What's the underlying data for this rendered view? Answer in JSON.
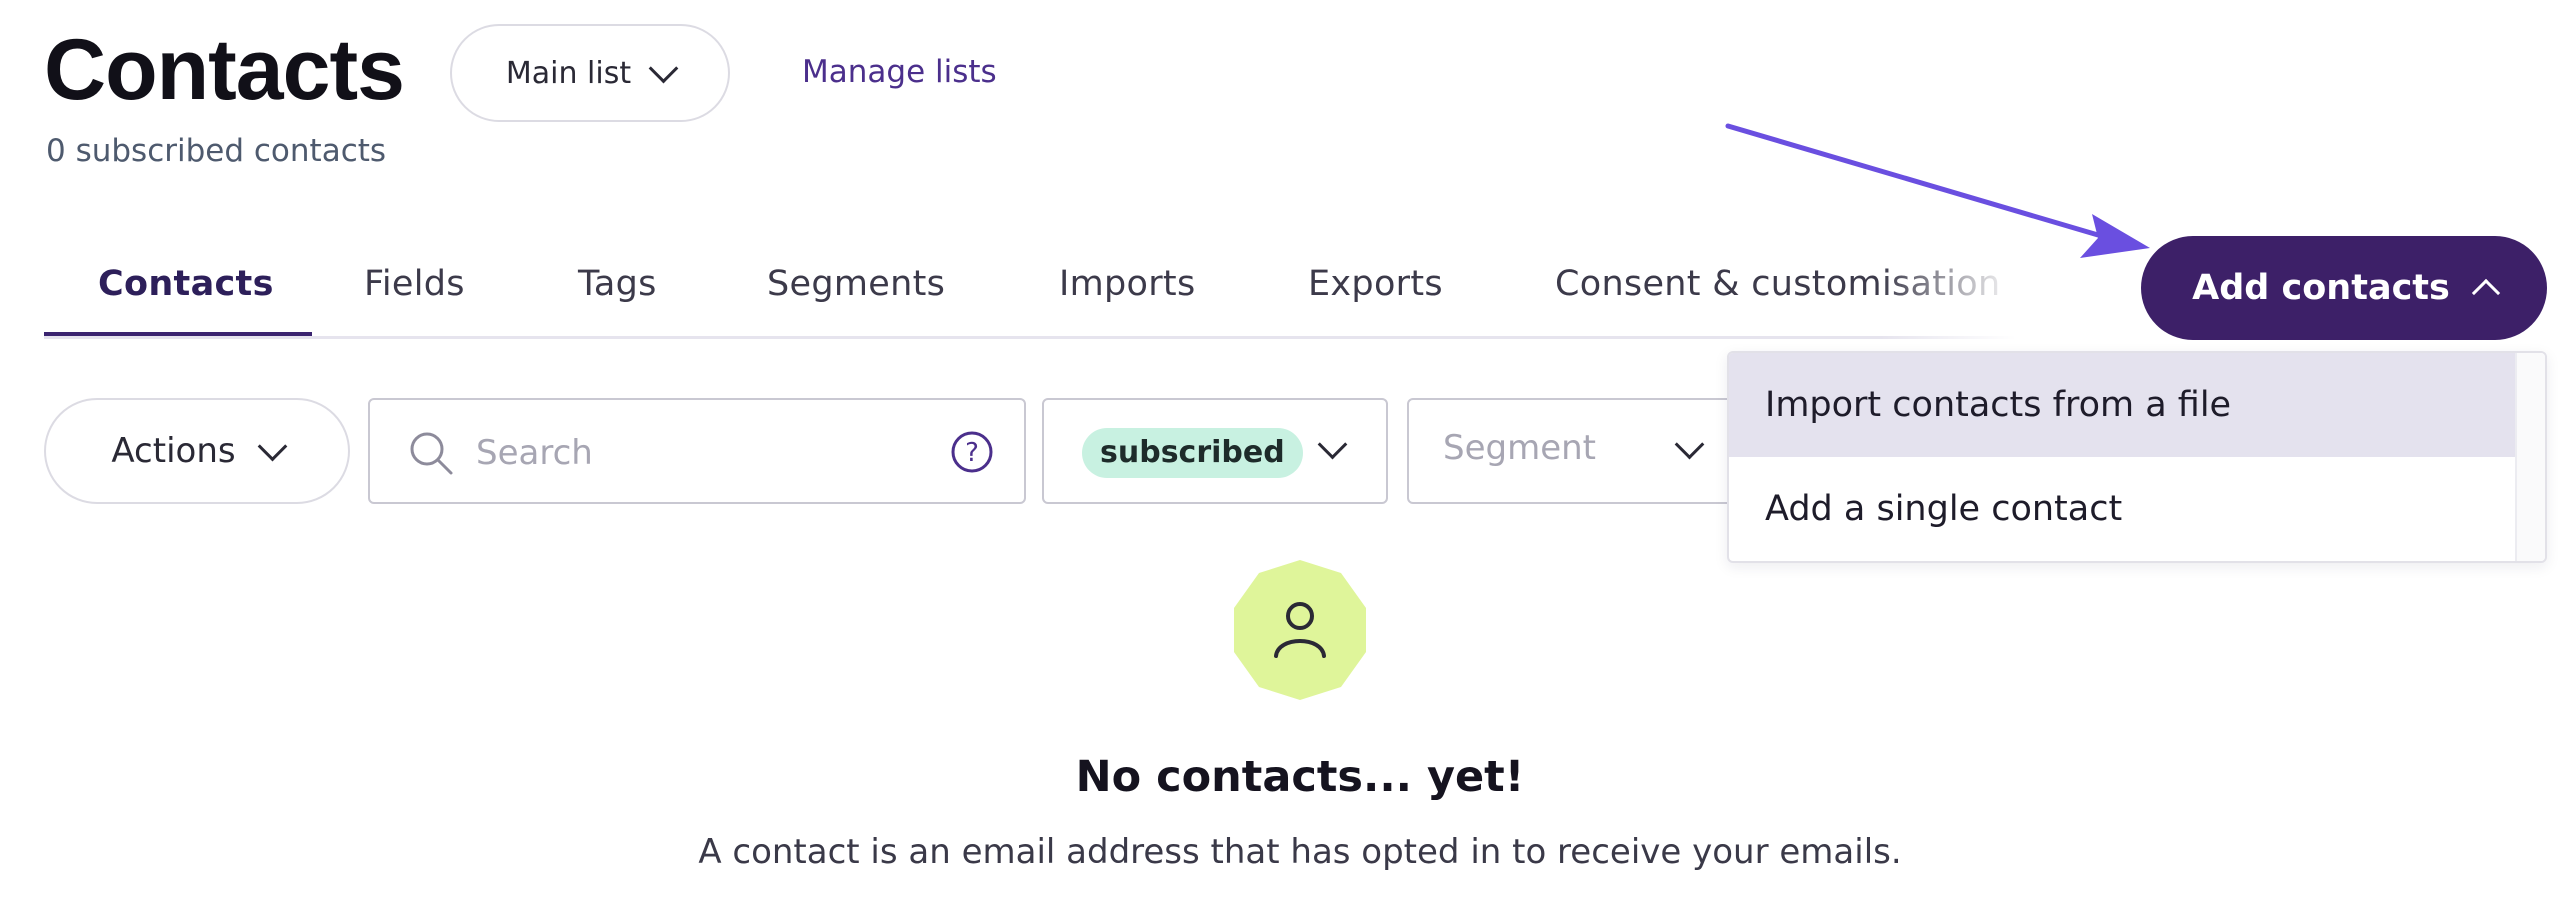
{
  "header": {
    "title": "Contacts",
    "list_selector": "Main list",
    "manage_lists_link": "Manage lists",
    "subscribed_count": "0 subscribed contacts"
  },
  "tabs": [
    {
      "label": "Contacts",
      "active": true
    },
    {
      "label": "Fields"
    },
    {
      "label": "Tags"
    },
    {
      "label": "Segments"
    },
    {
      "label": "Imports"
    },
    {
      "label": "Exports"
    },
    {
      "label": "Consent & customisation"
    }
  ],
  "add_contacts": {
    "label": "Add contacts",
    "menu": [
      {
        "label": "Import contacts from a file",
        "highlighted": true
      },
      {
        "label": "Add a single contact"
      }
    ]
  },
  "filters": {
    "actions_label": "Actions",
    "search_placeholder": "Search",
    "search_value": "",
    "status_value": "subscribed",
    "segment_placeholder": "Segment"
  },
  "empty_state": {
    "title": "No contacts... yet!",
    "description": "A contact is an email address that has opted in to receive your emails."
  },
  "colors": {
    "primary": "#3d2068",
    "tab_active": "#2d1f5a",
    "status_pill": "#c8f1e1",
    "empty_icon_bg": "#dff59a",
    "annotation_arrow": "#6a4fe0",
    "menu_highlight": "#e4e2ee"
  },
  "icons": [
    "chevron-down-icon",
    "chevron-up-icon",
    "search-icon",
    "help-icon",
    "user-icon",
    "annotation-arrow"
  ]
}
